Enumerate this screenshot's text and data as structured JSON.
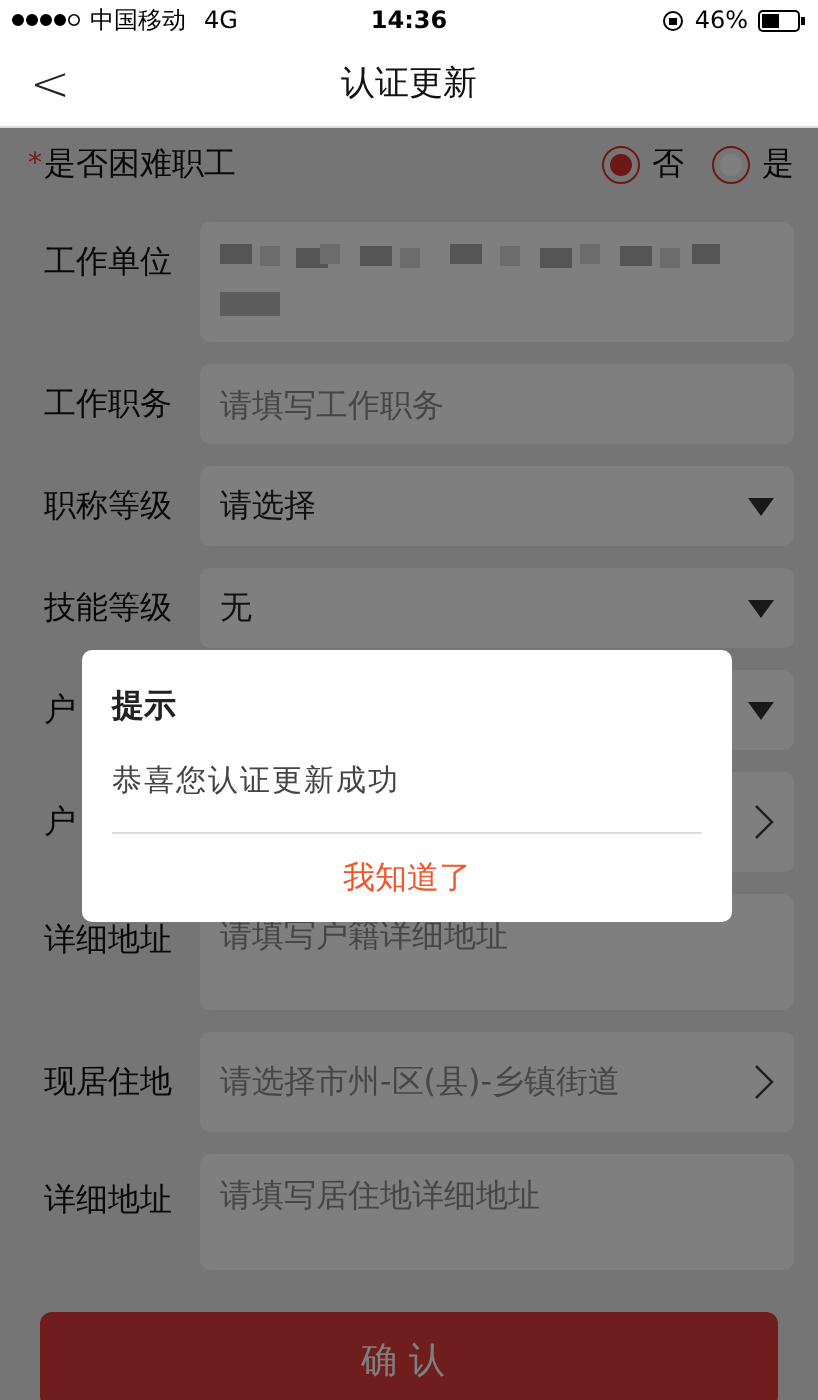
{
  "status_bar": {
    "carrier": "中国移动",
    "network": "4G",
    "time": "14:36",
    "battery": "46%"
  },
  "nav": {
    "back": "<",
    "title": "认证更新"
  },
  "hardship": {
    "label": "是否困难职工",
    "required_mark": "*",
    "options": [
      {
        "label": "否",
        "selected": true
      },
      {
        "label": "是",
        "selected": false
      }
    ]
  },
  "fields": [
    {
      "kind": "redacted",
      "label": "工作单位"
    },
    {
      "kind": "text",
      "label": "工作职务",
      "placeholder": "请填写工作职务"
    },
    {
      "kind": "select",
      "label": "职称等级",
      "value": "请选择"
    },
    {
      "kind": "select",
      "label": "技能等级",
      "value": "无"
    },
    {
      "kind": "select",
      "label": "户"
    },
    {
      "kind": "picker",
      "label": "户"
    },
    {
      "kind": "textarea",
      "label": "详细地址",
      "placeholder": "请填写户籍详细地址"
    },
    {
      "kind": "picker",
      "label": "现居住地",
      "placeholder": "请选择市州-区(县)-乡镇街道"
    },
    {
      "kind": "textarea",
      "label": "详细地址",
      "placeholder": "请填写居住地详细地址"
    }
  ],
  "submit": "确认",
  "dialog": {
    "title": "提示",
    "message": "恭喜您认证更新成功",
    "button": "我知道了"
  }
}
